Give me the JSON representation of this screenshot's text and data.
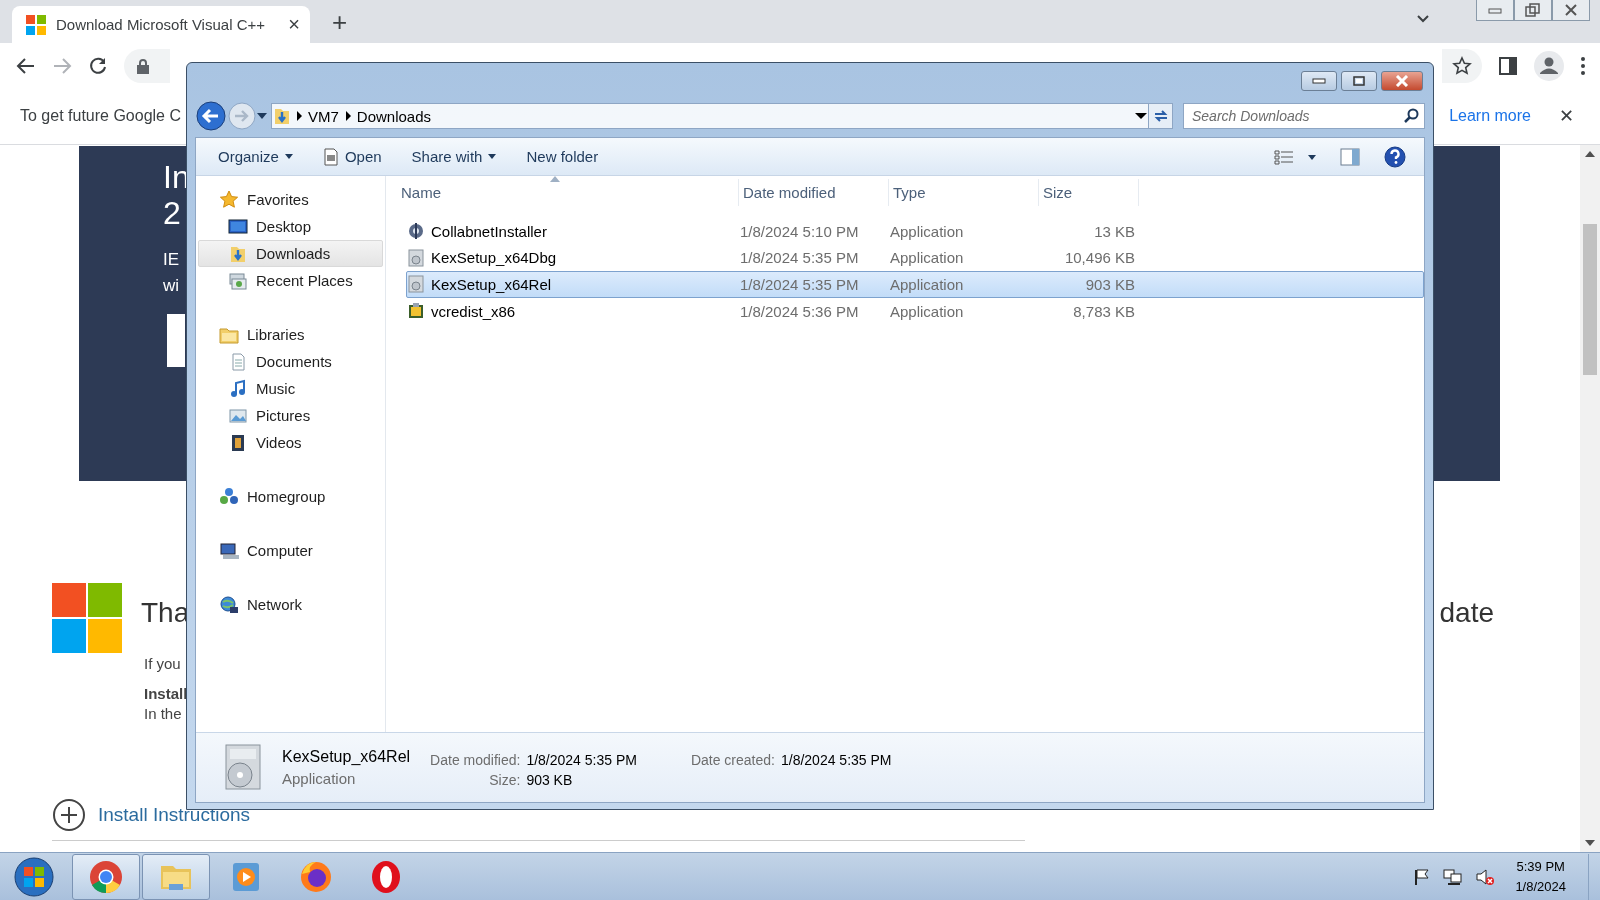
{
  "browser": {
    "tab": {
      "title": "Download Microsoft Visual C++",
      "close": "×"
    },
    "new_tab": "+",
    "infobar": {
      "text": "To get future Google C",
      "link": "Learn more",
      "close": "✕"
    }
  },
  "page": {
    "banner": {
      "heading_lines": [
        "In",
        "2"
      ],
      "body_lines": [
        "IE",
        "wi"
      ]
    },
    "heading_left": "Tha",
    "heading_right": "date",
    "paragraph_lines": [
      {
        "text": "If you",
        "kind": "normal"
      },
      {
        "text": "Install",
        "kind": "bold"
      },
      {
        "text": "In the",
        "kind": "normal"
      }
    ],
    "install_link": "Install Instructions"
  },
  "explorer": {
    "breadcrumb": [
      "VM7",
      "Downloads"
    ],
    "search": {
      "placeholder": "Search Downloads"
    },
    "toolbar": [
      {
        "label": "Organize",
        "dropdown": true,
        "icon": false
      },
      {
        "label": "Open",
        "dropdown": false,
        "icon": true
      },
      {
        "label": "Share with",
        "dropdown": true,
        "icon": false
      },
      {
        "label": "New folder",
        "dropdown": false,
        "icon": false
      }
    ],
    "nav": [
      {
        "label": "Favorites",
        "selected": false,
        "children": [
          {
            "label": "Desktop",
            "selected": false
          },
          {
            "label": "Downloads",
            "selected": true
          },
          {
            "label": "Recent Places",
            "selected": false
          }
        ]
      },
      {
        "label": "Libraries",
        "selected": false,
        "children": [
          {
            "label": "Documents",
            "selected": false
          },
          {
            "label": "Music",
            "selected": false
          },
          {
            "label": "Pictures",
            "selected": false
          },
          {
            "label": "Videos",
            "selected": false
          }
        ]
      },
      {
        "label": "Homegroup",
        "selected": false
      },
      {
        "label": "Computer",
        "selected": false
      },
      {
        "label": "Network",
        "selected": false
      }
    ],
    "columns": [
      {
        "label": "Name",
        "sorted": true
      },
      {
        "label": "Date modified",
        "sorted": false
      },
      {
        "label": "Type",
        "sorted": false
      },
      {
        "label": "Size",
        "sorted": false
      }
    ],
    "rows": [
      {
        "name": "CollabnetInstaller",
        "date": "1/8/2024 5:10 PM",
        "type": "Application",
        "size": "13 KB",
        "selected": false
      },
      {
        "name": "KexSetup_x64Dbg",
        "date": "1/8/2024 5:35 PM",
        "type": "Application",
        "size": "10,496 KB",
        "selected": false
      },
      {
        "name": "KexSetup_x64Rel",
        "date": "1/8/2024 5:35 PM",
        "type": "Application",
        "size": "903 KB",
        "selected": true
      },
      {
        "name": "vcredist_x86",
        "date": "1/8/2024 5:36 PM",
        "type": "Application",
        "size": "8,783 KB",
        "selected": false
      }
    ],
    "details": {
      "name": "KexSetup_x64Rel",
      "type": "Application",
      "fields": [
        {
          "label": "Date modified:",
          "value": "1/8/2024 5:35 PM"
        },
        {
          "label": "Size:",
          "value": "903 KB"
        },
        {
          "label": "Date created:",
          "value": "1/8/2024 5:35 PM"
        }
      ]
    }
  },
  "taskbar": {
    "apps": [
      {
        "selected": true
      },
      {
        "selected": true
      },
      {
        "selected": false
      },
      {
        "selected": false
      },
      {
        "selected": false
      }
    ],
    "clock": {
      "time": "5:39 PM",
      "date": "1/8/2024"
    }
  }
}
